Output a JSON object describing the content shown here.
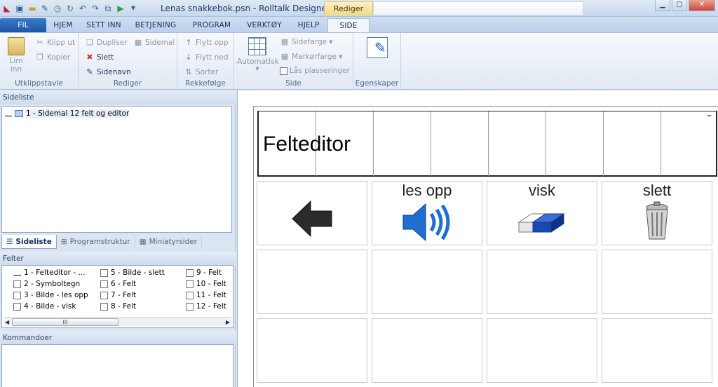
{
  "title_bar": {
    "title": "Lenas snakkebok.psn - Rolltalk Designer",
    "context_tab": "Rediger",
    "quick_access": [
      "app-icon",
      "save-icon",
      "open-icon",
      "tools-icon",
      "clock-icon",
      "refresh-icon",
      "undo-icon",
      "redo-icon",
      "edit-icon",
      "play-icon",
      "dropdown-icon"
    ]
  },
  "ribbon_tabs": [
    "FIL",
    "HJEM",
    "SETT INN",
    "BETJENING",
    "PROGRAM",
    "VERKTØY",
    "HJELP",
    "SIDE"
  ],
  "active_tab": "SIDE",
  "ribbon": {
    "clipboard": {
      "paste": "Lim",
      "paste2": "inn",
      "cut": "Klipp ut",
      "copy": "Kopier",
      "label": "Utklippstavle"
    },
    "edit": {
      "duplicate": "Dupliser",
      "template": "Sidemal",
      "delete": "Slett",
      "page_name": "Sidenavn",
      "label": "Rediger"
    },
    "order": {
      "move_up": "Flytt opp",
      "move_down": "Flytt ned",
      "sort": "Sorter",
      "label": "Rekkefølge"
    },
    "page": {
      "automatic": "Automatisk",
      "page_color": "Sidefarge",
      "marker_color": "Markørfarge",
      "lock": "Lås plasseringer",
      "label": "Side"
    },
    "properties": {
      "label": "Egenskaper"
    }
  },
  "left_panel": {
    "sideliste_header": "Sideliste",
    "tree_item": "1 - Sidemal 12 felt og editor",
    "bottom_tabs": [
      "Sideliste",
      "Programstruktur",
      "Miniatyrsider"
    ],
    "felter_header": "Felter",
    "felter": [
      [
        "1 - Felteditor - ...",
        "2 - Symboltegn",
        "3 - Bilde - les opp",
        "4 - Bilde - visk"
      ],
      [
        "5 - Bilde - slett",
        "6 - Felt",
        "7 - Felt",
        "8 - Felt"
      ],
      [
        "9 - Felt",
        "10 - Felt",
        "11 - Felt",
        "12 - Felt"
      ]
    ],
    "scroll_grip": "III",
    "kommandoer_header": "Kommandoer"
  },
  "main": {
    "editor_text": "Felteditor",
    "editor_minus": "–",
    "cells": [
      {
        "label": "",
        "icon": "left-arrow-icon"
      },
      {
        "label": "les opp",
        "icon": "speaker-icon"
      },
      {
        "label": "visk",
        "icon": "eraser-icon"
      },
      {
        "label": "slett",
        "icon": "trash-icon"
      }
    ]
  },
  "colors": {
    "accent": "#1d57a6",
    "ribbon_bg": "#e1e9f4",
    "panel_bg": "#dbe5f1"
  }
}
